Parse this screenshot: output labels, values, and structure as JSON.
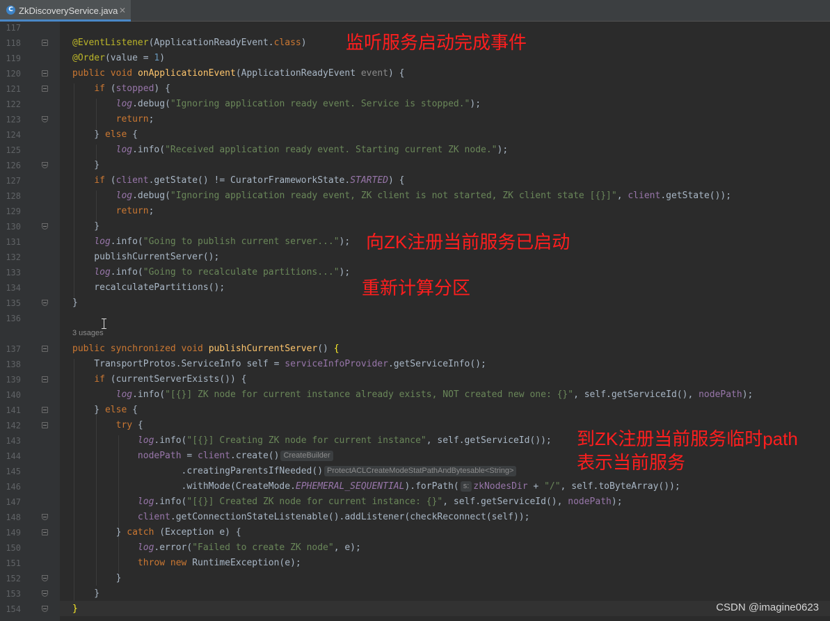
{
  "tab": {
    "filename": "ZkDiscoveryService.java",
    "type_icon": "C",
    "close": "✕"
  },
  "usages_hint": "3 usages",
  "watermark": "CSDN @imagine0623",
  "annotations": [
    "监听服务启动完成事件",
    "向ZK注册当前服务已启动",
    "重新计算分区",
    "到ZK注册当前服务临时path",
    "表示当前服务"
  ],
  "inlay_hints": [
    "CreateBuilder",
    "ProtectACLCreateModeStatPathAndBytesable<String>",
    "s:"
  ],
  "line_numbers": [
    "117",
    "118",
    "119",
    "120",
    "121",
    "122",
    "123",
    "124",
    "125",
    "126",
    "127",
    "128",
    "129",
    "130",
    "131",
    "132",
    "133",
    "134",
    "135",
    "136",
    "137",
    "138",
    "139",
    "140",
    "141",
    "142",
    "143",
    "144",
    "145",
    "146",
    "147",
    "148",
    "149",
    "150",
    "151",
    "152",
    "153",
    "154"
  ],
  "code": [
    "",
    "@EventListener(ApplicationReadyEvent.class)",
    "@Order(value = 1)",
    "public void onApplicationEvent(ApplicationReadyEvent event) {",
    "    if (stopped) {",
    "        log.debug(\"Ignoring application ready event. Service is stopped.\");",
    "        return;",
    "    } else {",
    "        log.info(\"Received application ready event. Starting current ZK node.\");",
    "    }",
    "    if (client.getState() != CuratorFrameworkState.STARTED) {",
    "        log.debug(\"Ignoring application ready event, ZK client is not started, ZK client state [{}]\", client.getState());",
    "        return;",
    "    }",
    "    log.info(\"Going to publish current server...\");",
    "    publishCurrentServer();",
    "    log.info(\"Going to recalculate partitions...\");",
    "    recalculatePartitions();",
    "}",
    "",
    "public synchronized void publishCurrentServer() {",
    "    TransportProtos.ServiceInfo self = serviceInfoProvider.getServiceInfo();",
    "    if (currentServerExists()) {",
    "        log.info(\"[{}] ZK node for current instance already exists, NOT created new one: {}\", self.getServiceId(), nodePath);",
    "    } else {",
    "        try {",
    "            log.info(\"[{}] Creating ZK node for current instance\", self.getServiceId());",
    "            nodePath = client.create()",
    "                    .creatingParentsIfNeeded()",
    "                    .withMode(CreateMode.EPHEMERAL_SEQUENTIAL).forPath(zkNodesDir + \"/\", self.toByteArray());",
    "            log.info(\"[{}] Created ZK node for current instance: {}\", self.getServiceId(), nodePath);",
    "            client.getConnectionStateListenable().addListener(checkReconnect(self));",
    "        } catch (Exception e) {",
    "            log.error(\"Failed to create ZK node\", e);",
    "            throw new RuntimeException(e);",
    "        }",
    "    }",
    "}"
  ]
}
